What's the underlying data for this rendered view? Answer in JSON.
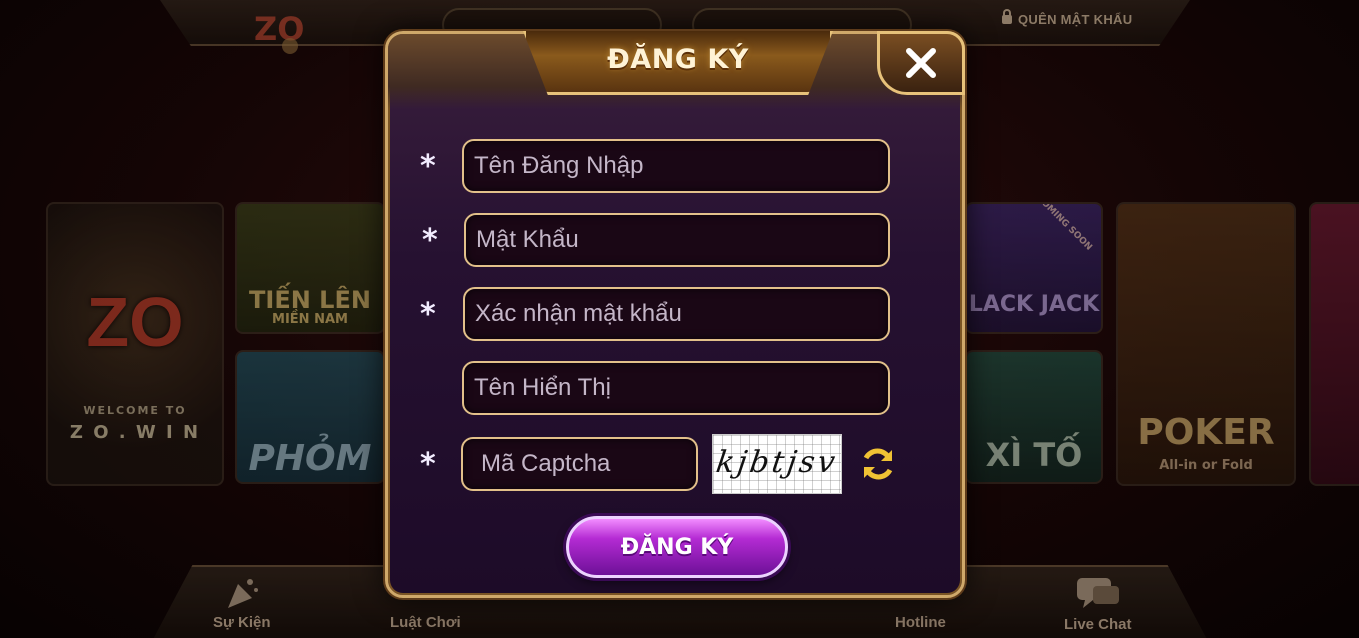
{
  "background": {
    "forgot_password": "QUÊN MẬT KHẨU",
    "tiles": {
      "welcome_logo": "ZO",
      "welcome_text": "WELCOME TO",
      "welcome_brand": "Z O . W I N",
      "tienlen": "TIẾN LÊN",
      "tienlen_sub": "MIỀN NAM",
      "phom": "PHỎM",
      "blackjack": "LACK JACK",
      "coming_soon": "COMING SOON",
      "xito": "XÌ TỐ",
      "poker": "POKER",
      "poker_sub": "All-in or Fold"
    },
    "bottom_nav": {
      "su_kien": "Sự Kiện",
      "luat_choi": "Luật Chơi",
      "hotline": "Hotline",
      "live_chat": "Live Chat"
    }
  },
  "modal": {
    "title": "ĐĂNG KÝ",
    "fields": {
      "username": {
        "placeholder": "Tên Đăng Nhập",
        "required_mark": "*"
      },
      "password": {
        "placeholder": "Mật Khẩu",
        "required_mark": "*"
      },
      "confirm_password": {
        "placeholder": "Xác nhận mật khẩu",
        "required_mark": "*"
      },
      "display_name": {
        "placeholder": "Tên Hiển Thị"
      },
      "captcha": {
        "placeholder": "Mã Captcha",
        "required_mark": "*"
      }
    },
    "captcha_image_text": "kjbtjsv",
    "submit_label": "ĐĂNG KÝ"
  },
  "colors": {
    "gold_border": "#e2c08a",
    "modal_bg": "#261131",
    "submit_purple": "#b42bd3"
  }
}
